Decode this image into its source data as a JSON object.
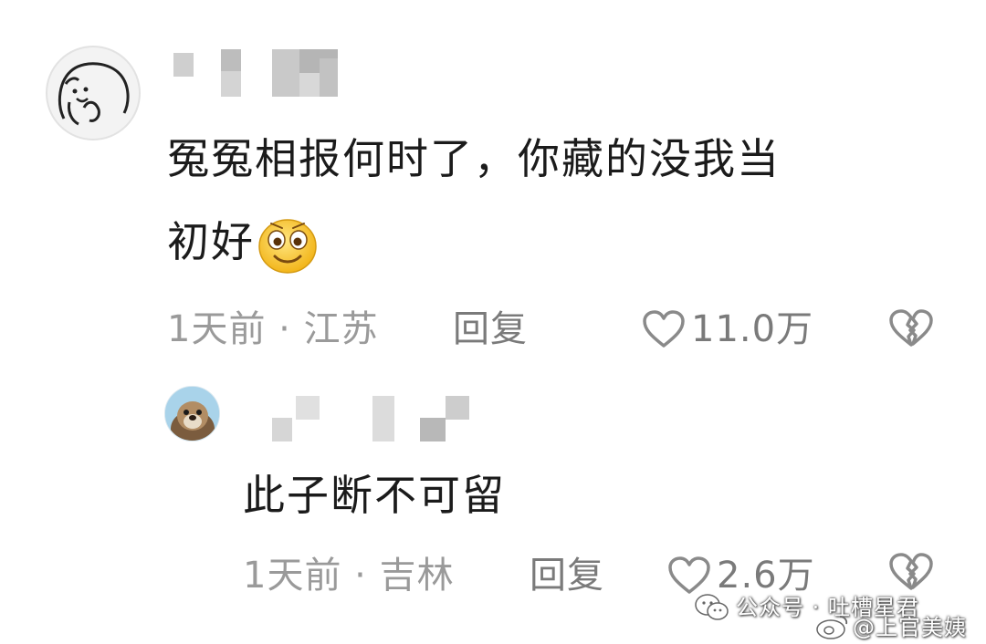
{
  "comments": [
    {
      "text_line1": "冤冤相报何时了，你藏的没我当",
      "text_line2": "初好",
      "time": "1天前 · 江苏",
      "reply_label": "回复",
      "likes": "11.0万",
      "avatar_icon": "cartoon-doodle-avatar",
      "emoji": "smile-emoji"
    },
    {
      "text": "此子断不可留",
      "time": "1天前 · 吉林",
      "reply_label": "回复",
      "likes": "2.6万",
      "avatar_icon": "otter-photo-avatar"
    }
  ],
  "watermark": {
    "wechat": "公众号 · 吐槽星君",
    "weibo": "@上官美姨"
  },
  "colors": {
    "text": "#1b1b1b",
    "meta": "#9a9a9a",
    "emoji_yellow": "#f7c52e"
  }
}
